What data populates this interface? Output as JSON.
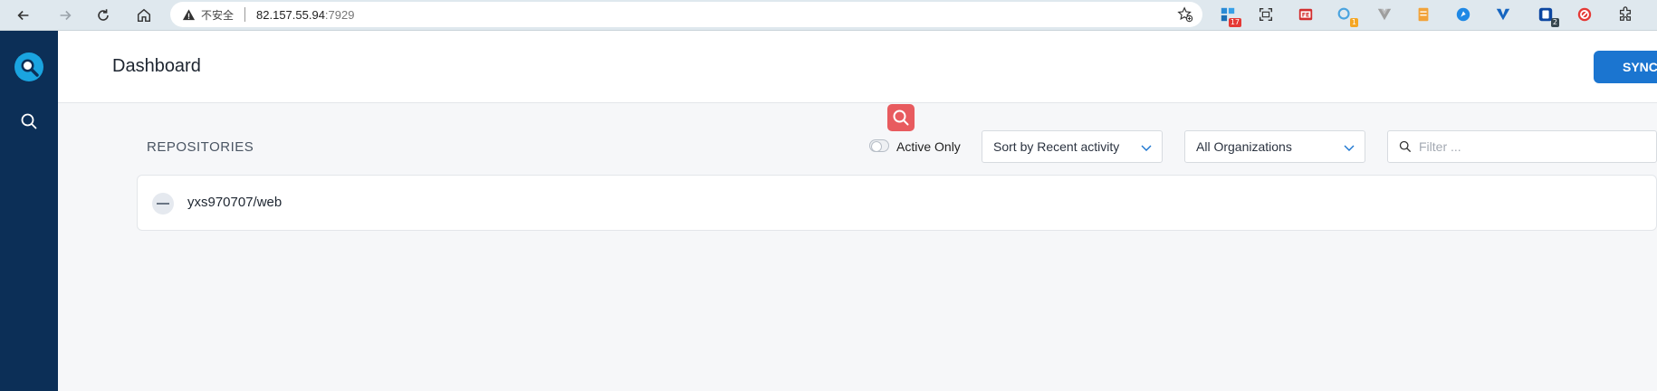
{
  "browser": {
    "insecure_label": "不安全",
    "url_host": "82.157.55.94",
    "url_port": ":7929",
    "extensions": [
      {
        "name": "ext-1",
        "badge": "17",
        "color": "#2a8bd6",
        "badge_color": "#e53935"
      },
      {
        "name": "screenshot-ext",
        "badge": "",
        "color": "#333333"
      },
      {
        "name": "fe-ext",
        "badge": "",
        "color": "#d32f2f"
      },
      {
        "name": "search-ext",
        "badge": "1",
        "color": "#4aa3df",
        "badge_color": "#f5a623"
      },
      {
        "name": "vue-ext",
        "badge": "",
        "color": "#9e9e9e"
      },
      {
        "name": "note-ext",
        "badge": "",
        "color": "#f2a33a"
      },
      {
        "name": "browse-ext",
        "badge": "",
        "color": "#1e88e5"
      },
      {
        "name": "v-ext",
        "badge": "",
        "color": "#1565c0"
      },
      {
        "name": "dash-ext",
        "badge": "2",
        "color": "#0d47a1",
        "badge_color": "#37474f"
      },
      {
        "name": "block-ext",
        "badge": "",
        "color": "#e53935"
      },
      {
        "name": "puzzle-ext",
        "badge": "",
        "color": "#333333"
      }
    ]
  },
  "header": {
    "title": "Dashboard",
    "sync_label": "SYNC"
  },
  "repositories": {
    "title": "REPOSITORIES",
    "active_only_label": "Active Only",
    "sort_value": "Sort by Recent activity",
    "org_value": "All Organizations",
    "filter_placeholder": "Filter ...",
    "items": [
      {
        "name": "yxs970707/web"
      }
    ]
  },
  "colors": {
    "sidebar": "#0c2f57",
    "accent": "#1b75d0",
    "float_search": "#e85b5f"
  }
}
